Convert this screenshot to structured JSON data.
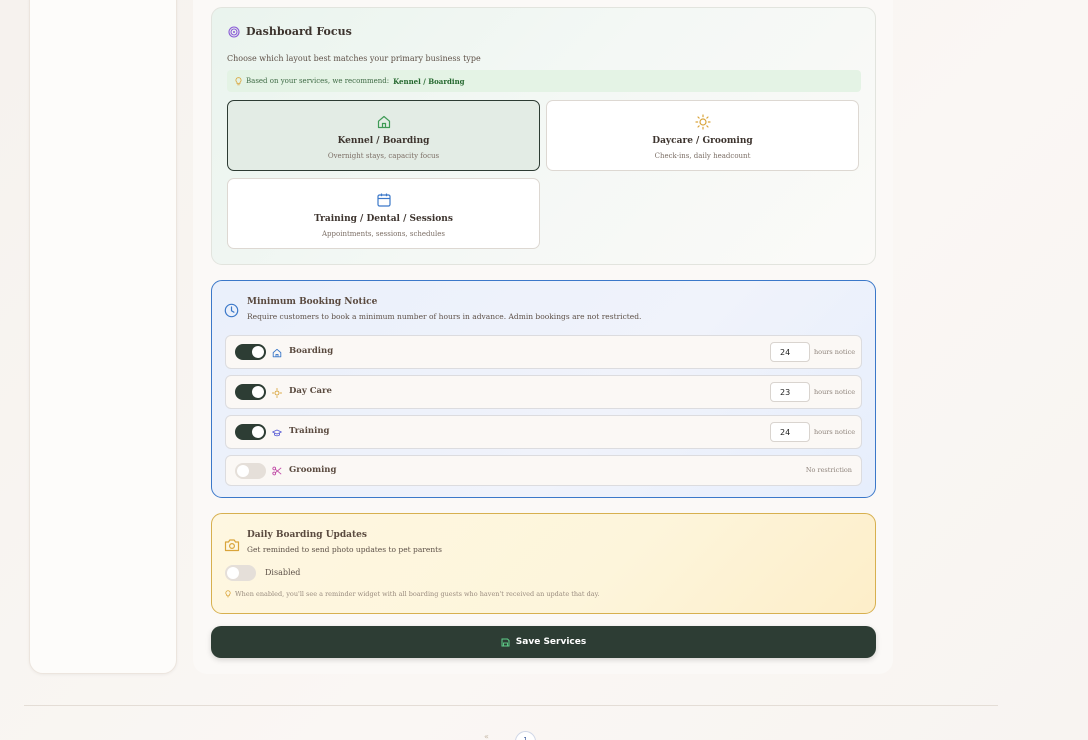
{
  "focus": {
    "title": "Dashboard Focus",
    "subtitle": "Choose which layout best matches your primary business type",
    "recommend_prefix": "Based on your services, we recommend:",
    "recommend_value": "Kennel / Boarding",
    "options": [
      {
        "title": "Kennel / Boarding",
        "desc": "Overnight stays, capacity focus",
        "icon": "house-icon",
        "selected": true
      },
      {
        "title": "Daycare / Grooming",
        "desc": "Check-ins, daily headcount",
        "icon": "sun-icon",
        "selected": false
      },
      {
        "title": "Training / Dental / Sessions",
        "desc": "Appointments, sessions, schedules",
        "icon": "calendar-icon",
        "selected": false
      }
    ]
  },
  "notice": {
    "title": "Minimum Booking Notice",
    "subtitle": "Require customers to book a minimum number of hours in advance. Admin bookings are not restricted.",
    "rows": [
      {
        "label": "Boarding",
        "enabled": true,
        "hours": "24",
        "unit": "hours notice",
        "icon": "house-icon"
      },
      {
        "label": "Day Care",
        "enabled": true,
        "hours": "23",
        "unit": "hours notice",
        "icon": "sun-icon"
      },
      {
        "label": "Training",
        "enabled": true,
        "hours": "24",
        "unit": "hours notice",
        "icon": "graduation-cap-icon"
      },
      {
        "label": "Grooming",
        "enabled": false,
        "status": "No restriction",
        "icon": "scissors-icon"
      }
    ]
  },
  "daily": {
    "title": "Daily Boarding Updates",
    "subtitle": "Get reminded to send photo updates to pet parents",
    "state": "Disabled",
    "hint": "When enabled, you'll see a reminder widget with all boarding guests who haven't received an update that day."
  },
  "save": {
    "label": "Save Services"
  },
  "pager": {
    "prev": "«",
    "current": "1"
  },
  "colors": {
    "primary": "#2d3d34",
    "notice_border": "#3b78c9",
    "daily_border": "#d7b04f",
    "recommend_bg": "#e4f3e5"
  }
}
